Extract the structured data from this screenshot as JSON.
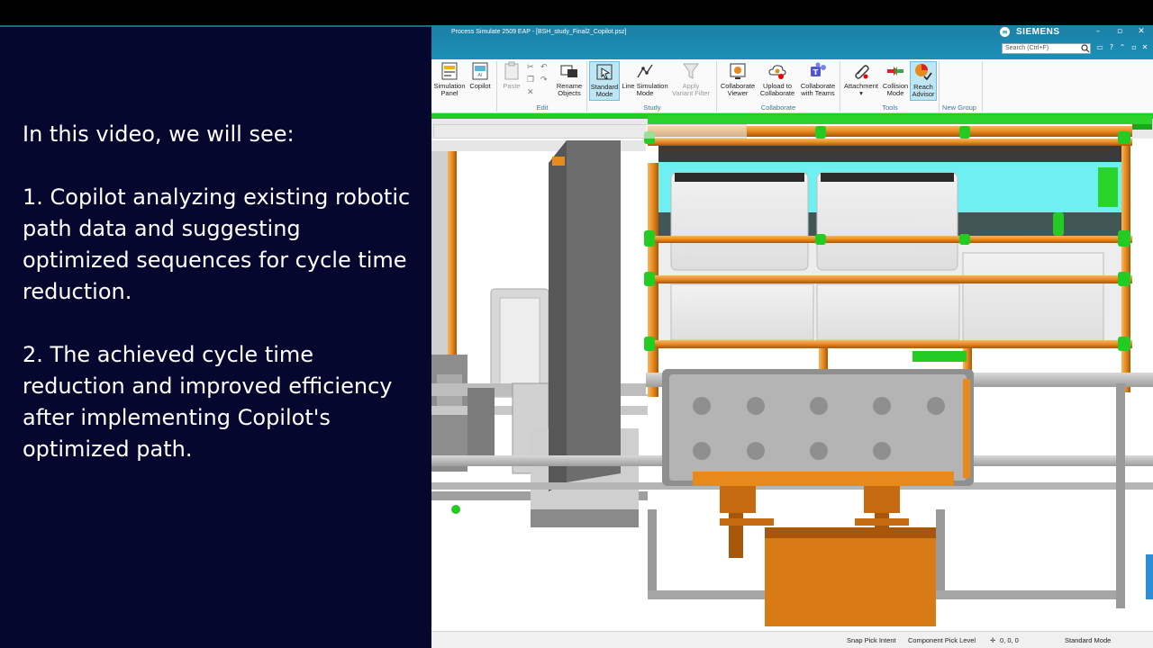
{
  "narration": {
    "intro": "In this video, we will see:",
    "points": [
      "1.  Copilot analyzing existing robotic path data and suggesting optimized sequences for cycle time reduction.",
      "2.  The achieved cycle time reduction and improved efficiency after implementing Copilot's optimized path."
    ]
  },
  "window": {
    "title": "Process Simulate 2509 EAP - [BSH_study_Final2_Copilot.psz]",
    "brand": "SIEMENS",
    "search_placeholder": "Search (Ctrl+F)"
  },
  "ribbon": {
    "buttons": [
      {
        "line1": "Simulation",
        "line2": "Panel"
      },
      {
        "line1": "Copilot",
        "line2": ""
      },
      {
        "line1": "Paste",
        "line2": ""
      },
      {
        "line1": "Rename",
        "line2": "Objects"
      },
      {
        "line1": "Standard",
        "line2": "Mode"
      },
      {
        "line1": "Line Simulation",
        "line2": "Mode"
      },
      {
        "line1": "Apply",
        "line2": "Variant Filter"
      },
      {
        "line1": "Collaborate",
        "line2": "Viewer"
      },
      {
        "line1": "Upload to",
        "line2": "Collaborate"
      },
      {
        "line1": "Collaborate",
        "line2": "with Teams"
      },
      {
        "line1": "Attachment",
        "line2": "▾"
      },
      {
        "line1": "Collision",
        "line2": "Mode"
      },
      {
        "line1": "Reach",
        "line2": "Advisor"
      }
    ],
    "groups": [
      "Edit",
      "Study",
      "Collaborate",
      "Tools",
      "New Group"
    ]
  },
  "statusbar": {
    "snap": "Snap Pick Intent",
    "component": "Component Pick Level",
    "coords": "0, 0, 0",
    "mode": "Standard Mode"
  },
  "colors": {
    "narration_bg": "#06072e",
    "titlebar": "#1b87ad",
    "frame_green": "#22cc22",
    "pipe_orange": "#e8891c",
    "cyan_panel": "#6ff0f0"
  }
}
